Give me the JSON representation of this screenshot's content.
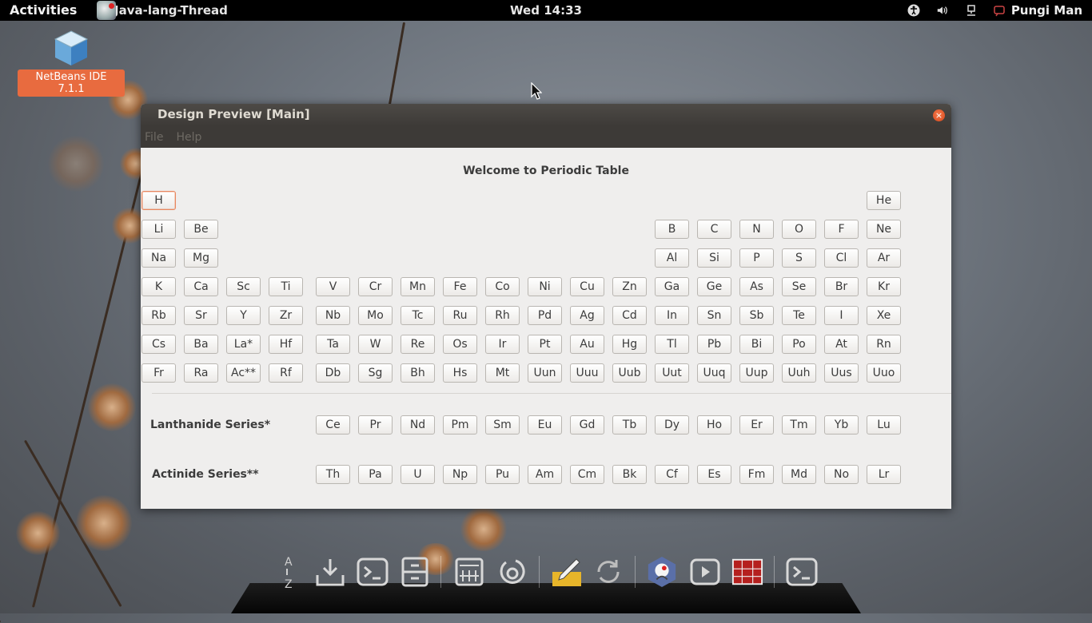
{
  "topbar": {
    "activities": "Activities",
    "app_name": "Java-lang-Thread",
    "clock": "Wed 14:33",
    "user": "Pungi Man",
    "tray_icons": [
      "accessibility-icon",
      "volume-icon",
      "network-icon",
      "user-status-icon"
    ]
  },
  "desktop": {
    "icon_label": "NetBeans IDE 7.1.1"
  },
  "window": {
    "title": "Design Preview [Main]",
    "close_symbol": "×",
    "menu": {
      "file": "File",
      "help": "Help"
    },
    "welcome": "Welcome to Periodic Table",
    "rows": [
      [
        "H",
        "He"
      ],
      [
        "Li",
        "Be",
        "B",
        "C",
        "N",
        "O",
        "F",
        "Ne"
      ],
      [
        "Na",
        "Mg",
        "Al",
        "Si",
        "P",
        "S",
        "Cl",
        "Ar"
      ],
      [
        "K",
        "Ca",
        "Sc",
        "Ti",
        "V",
        "Cr",
        "Mn",
        "Fe",
        "Co",
        "Ni",
        "Cu",
        "Zn",
        "Ga",
        "Ge",
        "As",
        "Se",
        "Br",
        "Kr"
      ],
      [
        "Rb",
        "Sr",
        "Y",
        "Zr",
        "Nb",
        "Mo",
        "Tc",
        "Ru",
        "Rh",
        "Pd",
        "Ag",
        "Cd",
        "In",
        "Sn",
        "Sb",
        "Te",
        "I",
        "Xe"
      ],
      [
        "Cs",
        "Ba",
        "La*",
        "Hf",
        "Ta",
        "W",
        "Re",
        "Os",
        "Ir",
        "Pt",
        "Au",
        "Hg",
        "Tl",
        "Pb",
        "Bi",
        "Po",
        "At",
        "Rn"
      ],
      [
        "Fr",
        "Ra",
        "Ac**",
        "Rf",
        "Db",
        "Sg",
        "Bh",
        "Hs",
        "Mt",
        "Uun",
        "Uuu",
        "Uub",
        "Uut",
        "Uuq",
        "Uup",
        "Uuh",
        "Uus",
        "Uuo"
      ]
    ],
    "lanthanide_label": "Lanthanide Series*",
    "lanthanides": [
      "Ce",
      "Pr",
      "Nd",
      "Pm",
      "Sm",
      "Eu",
      "Gd",
      "Tb",
      "Dy",
      "Ho",
      "Er",
      "Tm",
      "Yb",
      "Lu"
    ],
    "actinide_label": "Actinide Series**",
    "actinides": [
      "Th",
      "Pa",
      "U",
      "Np",
      "Pu",
      "Am",
      "Cm",
      "Bk",
      "Cf",
      "Es",
      "Fm",
      "Md",
      "No",
      "Lr"
    ]
  },
  "dock": {
    "items": [
      "text-editor-az-icon",
      "download-icon",
      "terminal-icon",
      "file-manager-icon",
      "calculator-icon",
      "refresh-icon",
      "notes-pencil-icon",
      "sync-icon",
      "java-app-icon",
      "media-player-icon",
      "periodic-table-app-icon",
      "terminal-icon-2"
    ]
  },
  "colors": {
    "accent": "#e86b3f",
    "focus": "#e8875f",
    "titlebar": "#3d3a37",
    "window_bg": "#efeeed"
  }
}
